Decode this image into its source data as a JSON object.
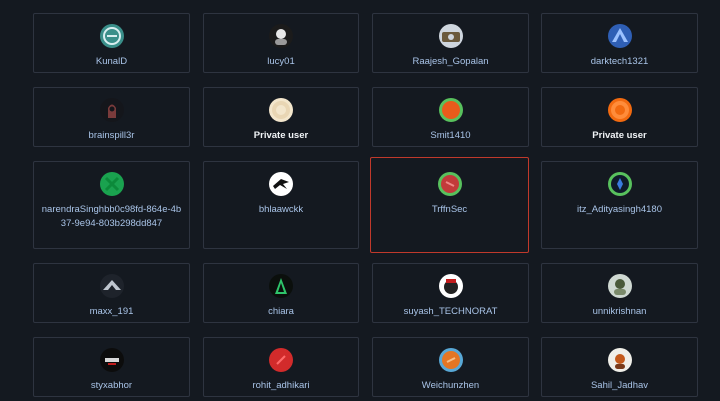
{
  "users": [
    {
      "name": "KunalD",
      "private": false,
      "icon": "avatar-kunald-icon",
      "colors": {
        "bg": "#3a8f8a",
        "fg": "#d8eef0"
      }
    },
    {
      "name": "lucy01",
      "private": false,
      "icon": "avatar-lucy01-icon",
      "colors": {
        "bg": "#1b1b1b",
        "fg": "#e8e8e8"
      }
    },
    {
      "name": "Raajesh_Gopalan",
      "private": false,
      "icon": "avatar-raajesh-gopalan-icon",
      "colors": {
        "bg": "#cfd6de",
        "fg": "#6b5a3d"
      }
    },
    {
      "name": "darktech1321",
      "private": false,
      "icon": "avatar-darktech1321-icon",
      "colors": {
        "bg": "#2f5fb5",
        "fg": "#9cc1ff"
      }
    },
    {
      "name": "brainspill3r",
      "private": false,
      "icon": "avatar-brainspill3r-icon",
      "colors": {
        "bg": "#14161b",
        "fg": "#7a3b3b"
      }
    },
    {
      "name": "Private user",
      "private": true,
      "icon": "avatar-private-user-icon",
      "colors": {
        "bg": "#f3e6cc",
        "fg": "#e9d6b4"
      }
    },
    {
      "name": "Smit1410",
      "private": false,
      "icon": "avatar-smit1410-icon",
      "colors": {
        "bg": "#e85b1b",
        "fg": "#58c15d"
      }
    },
    {
      "name": "Private user",
      "private": true,
      "icon": "avatar-private-user-2-icon",
      "colors": {
        "bg": "#f26a10",
        "fg": "#ff8c3a"
      }
    },
    {
      "name": "narendraSinghbb0c98fd-864e-4b37-9e94-803b298dd847",
      "private": false,
      "icon": "avatar-narendrasingh-icon",
      "colors": {
        "bg": "#1aa24f",
        "fg": "#0c8a3a"
      }
    },
    {
      "name": "bhlaawckk",
      "private": false,
      "icon": "avatar-bhlaawckk-icon",
      "colors": {
        "bg": "#ffffff",
        "fg": "#111111"
      }
    },
    {
      "name": "TrffnSec",
      "private": false,
      "icon": "avatar-trffnsec-icon",
      "colors": {
        "bg": "#c23a3a",
        "fg": "#58c15d"
      }
    },
    {
      "name": "itz_Adityasingh4180",
      "private": false,
      "icon": "avatar-itz-adityasingh4180-icon",
      "colors": {
        "bg": "#0f1a2a",
        "fg": "#58c15d"
      }
    },
    {
      "name": "maxx_191",
      "private": false,
      "icon": "avatar-maxx-191-icon",
      "colors": {
        "bg": "#1e232b",
        "fg": "#bfc6cf"
      }
    },
    {
      "name": "chiara",
      "private": false,
      "icon": "avatar-chiara-icon",
      "colors": {
        "bg": "#0b0f0c",
        "fg": "#2ec46a"
      }
    },
    {
      "name": "suyash_TECHNORAT",
      "private": false,
      "icon": "avatar-suyash-technorat-icon",
      "colors": {
        "bg": "#ffffff",
        "fg": "#c21d1d"
      }
    },
    {
      "name": "unnikrishnan",
      "private": false,
      "icon": "avatar-unnikrishnan-icon",
      "colors": {
        "bg": "#cfd9d2",
        "fg": "#4a5a3a"
      }
    },
    {
      "name": "styxabhor",
      "private": false,
      "icon": "avatar-styxabhor-icon",
      "colors": {
        "bg": "#0c0c0c",
        "fg": "#d8d8d8"
      }
    },
    {
      "name": "rohit_adhikari",
      "private": false,
      "icon": "avatar-rohit-adhikari-icon",
      "colors": {
        "bg": "#d22b2b",
        "fg": "#ff6a6a"
      }
    },
    {
      "name": "Weichunzhen",
      "private": false,
      "icon": "avatar-weichunzhen-icon",
      "colors": {
        "bg": "#e37624",
        "fg": "#58a8d6"
      }
    },
    {
      "name": "Sahil_Jadhav",
      "private": false,
      "icon": "avatar-sahil-jadhav-icon",
      "colors": {
        "bg": "#f0efe9",
        "fg": "#c45a1c"
      }
    }
  ]
}
